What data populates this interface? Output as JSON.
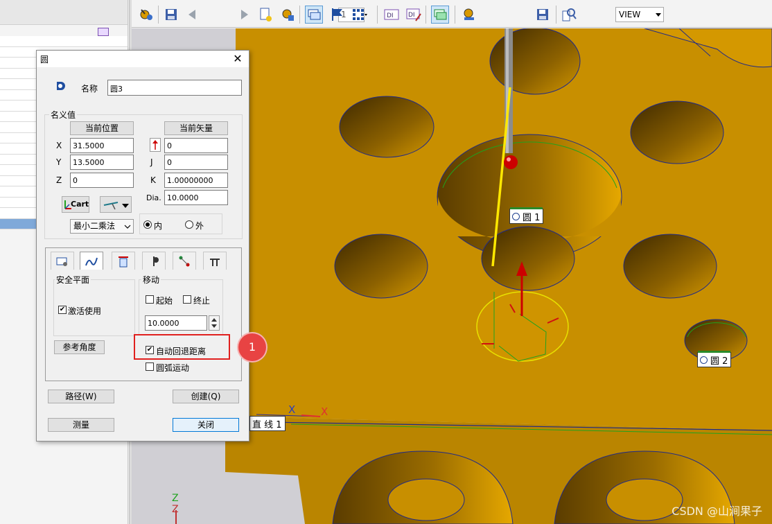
{
  "toolbar": {
    "page_value": "1",
    "view_value": "VIEW",
    "icons": [
      "probe-icon",
      "save-icon",
      "prev-arrow-icon",
      "page-field",
      "next-arrow-icon",
      "new-document-icon",
      "probe-settings-icon",
      "graphics-view-icon",
      "flag-icon",
      "dimension-grid-icon",
      "text-view-icon",
      "edit-view-icon",
      "graphics-toggle-icon",
      "probe-mode-icon",
      "view-combo",
      "save-view-icon",
      "zoom-icon"
    ]
  },
  "dialog": {
    "title": "圆",
    "close_label": "✕",
    "name_label": "名称",
    "name_value": "圆3",
    "nominal_group": "名义值",
    "current_position_button": "当前位置",
    "current_vector_button": "当前矢量",
    "x_label": "X",
    "x_value": "31.5000",
    "y_label": "Y",
    "y_value": "13.5000",
    "z_label": "Z",
    "z_value": "0",
    "i_value": "0",
    "j_label": "J",
    "j_value": "0",
    "k_label": "K",
    "k_value": "1.00000000",
    "dia_label": "Dia.",
    "dia_value": "10.0000",
    "cart_button": "Cart",
    "fit_method": "最小二乘法",
    "inner_label": "内",
    "outer_label": "外",
    "inner_selected": true,
    "safety_plane_group": "安全平面",
    "activate_label": "激活使用",
    "activate_checked": true,
    "move_group": "移动",
    "start_label": "起始",
    "end_label": "终止",
    "move_value": "10.0000",
    "ref_angle_button": "参考角度",
    "auto_retract_label": "自动回退距离",
    "auto_retract_checked": true,
    "arc_move_label": "圆弧运动",
    "path_button": "路径(W)",
    "create_button": "创建(Q)",
    "measure_button": "测量",
    "close_button": "关闭"
  },
  "callout": {
    "number": "1"
  },
  "viewport": {
    "circle1_label": "圆 1",
    "circle2_label": "圆 2",
    "line1_label": "直 线 1",
    "axis_x": "X",
    "axis_y": "X",
    "axis_z": "Z",
    "axis_z_bottom": "Z"
  },
  "watermark": "CSDN @山涧果子",
  "colors": {
    "part": "#c88f00",
    "selection": "#7fa9d9",
    "callout": "#e0201e"
  }
}
